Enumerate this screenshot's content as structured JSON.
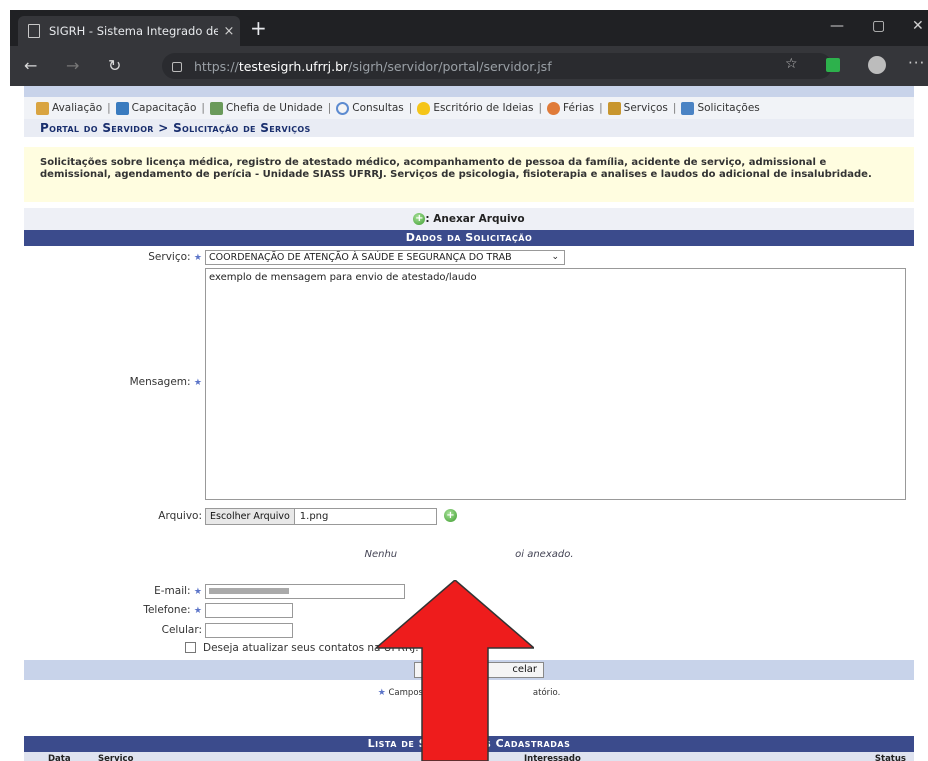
{
  "browser": {
    "tab_title": "SIGRH - Sistema Integrado de G",
    "tab_close": "×",
    "new_tab": "+",
    "url_prefix": "https://",
    "url_host": "testesigrh.ufrrj.br",
    "url_path": "/sigrh/servidor/portal/servidor.jsf",
    "minimize": "—",
    "maximize": "▢",
    "close": "✕",
    "back": "←",
    "forward": "→",
    "reload": "↻",
    "favorite": "☆",
    "menu": "···"
  },
  "menu": {
    "items": [
      "Avaliação",
      "Capacitação",
      "Chefia de Unidade",
      "Consultas",
      "Escritório de Ideias",
      "Férias",
      "Serviços",
      "Solicitações"
    ],
    "separator": "|"
  },
  "breadcrumb": "Portal do Servidor > Solicitação de Serviços",
  "info_text": "Solicitações sobre licença médica, registro de atestado médico, acompanhamento de pessoa da família, acidente de serviço, admissional e demissional, agendamento de perícia - Unidade SIASS UFRRJ. Serviços de psicologia, fisioterapia e analises e laudos do adicional de insalubridade.",
  "attach_bar": {
    "label": ": Anexar Arquivo",
    "icon": "+"
  },
  "form": {
    "title": "Dados da Solicitação",
    "servico_label": "Serviço:",
    "servico_value": "COORDENAÇÃO DE ATENÇÃO À SAÚDE E SEGURANÇA DO TRAB",
    "mensagem_label": "Mensagem:",
    "mensagem_value": "exemplo de mensagem para envio de atestado/laudo",
    "arquivo_label": "Arquivo:",
    "file_button": "Escolher Arquivo",
    "file_name": "1.png",
    "add_file_icon": "+",
    "no_file_left": "Nenhu",
    "no_file_right": "oi anexado.",
    "email_label": "E-mail:",
    "telefone_label": "Telefone:",
    "celular_label": "Celular:",
    "atualizar_label": "Deseja atualizar seus contatos na UFRRJ.",
    "cancel_button": "celar",
    "footnote_left": "Campos de pre",
    "footnote_right": "atório.",
    "required_mark": "★",
    "select_arrow": "⌄"
  },
  "list": {
    "title": "Lista de Solicitações Cadastradas",
    "columns": [
      "Data",
      "Serviço",
      "Interessado",
      "Status"
    ]
  },
  "colors": {
    "header_blue": "#3b4b8c",
    "info_yellow": "#fffde0",
    "arrow_red": "#ee1c1c"
  }
}
